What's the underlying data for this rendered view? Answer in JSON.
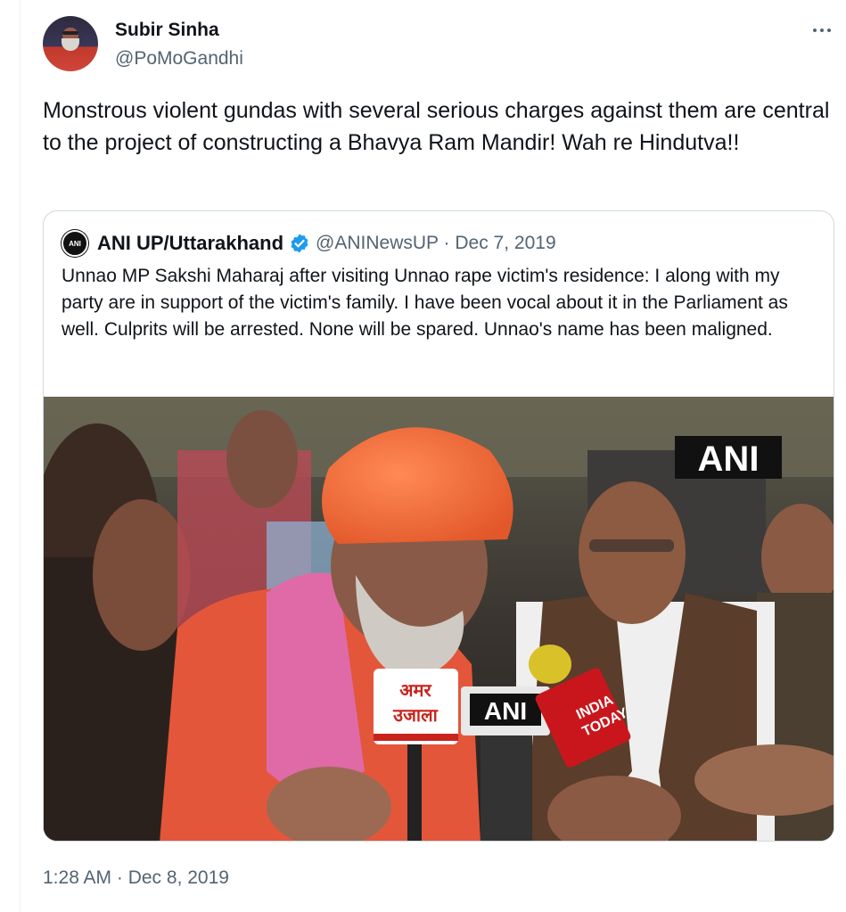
{
  "author": {
    "name": "Subir Sinha",
    "handle": "@PoMoGandhi"
  },
  "tweet": {
    "text": "Monstrous violent gundas with several serious charges against them are central to the project of constructing a Bhavya Ram Mandir! Wah re Hindutva!!",
    "timestamp": "1:28 AM · Dec 8, 2019"
  },
  "quoted": {
    "logo_text": "ANI",
    "name": "ANI UP/Uttarakhand",
    "handle": "@ANINewsUP",
    "separator": "·",
    "date": "Dec 7, 2019",
    "text": "Unnao MP Sakshi Maharaj after visiting Unnao rape victim's residence: I along with my party are in support of the victim's family. I have been vocal about it in the Parliament as well. Culprits will be arrested. None will be spared. Unnao's name has been maligned.",
    "media": {
      "watermark": "ANI",
      "mic_labels": [
        "अमर",
        "उजाला",
        "ANI",
        "INDIA",
        "TODAY"
      ]
    }
  },
  "colors": {
    "text": "#0f1419",
    "secondary": "#536471",
    "border": "#cfd9de",
    "verified": "#1d9bf0"
  },
  "icons": {
    "more": "more-horizontal-icon",
    "verified": "verified-badge-icon"
  }
}
